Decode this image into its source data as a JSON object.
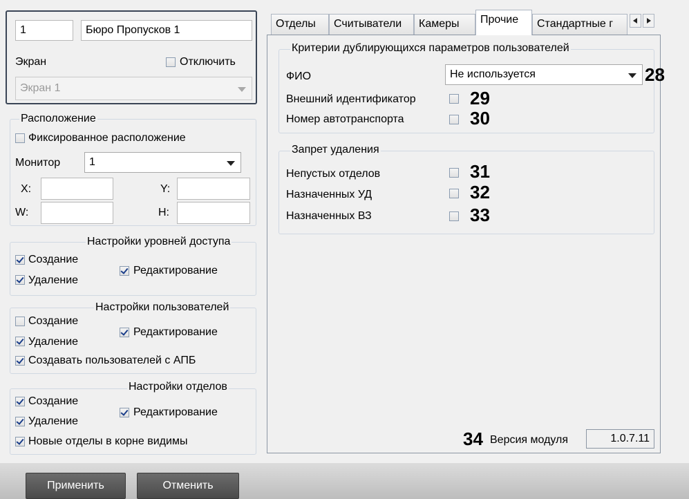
{
  "header": {
    "id_value": "1",
    "name_value": "Бюро Пропусков 1",
    "screen_label": "Экран",
    "disable_label": "Отключить",
    "screen_value": "Экран 1"
  },
  "location": {
    "title": "Расположение",
    "fixed_label": "Фиксированное расположение",
    "monitor_label": "Монитор",
    "monitor_value": "1",
    "x_label": "X:",
    "y_label": "Y:",
    "w_label": "W:",
    "h_label": "H:",
    "x_value": "",
    "y_value": "",
    "w_value": "",
    "h_value": ""
  },
  "access_levels": {
    "title": "Настройки уровней доступа",
    "create": "Создание",
    "delete": "Удаление",
    "edit": "Редактирование"
  },
  "users": {
    "title": "Настройки пользователей",
    "create": "Создание",
    "delete": "Удаление",
    "edit": "Редактирование",
    "apb": "Создавать пользователей с АПБ"
  },
  "departments": {
    "title": "Настройки отделов",
    "create": "Создание",
    "delete": "Удаление",
    "edit": "Редактирование",
    "root": "Новые отделы в корне видимы"
  },
  "tabs": [
    {
      "label": "Отделы"
    },
    {
      "label": "Считыватели"
    },
    {
      "label": "Камеры"
    },
    {
      "label": "Прочие"
    },
    {
      "label": "Стандартные г"
    }
  ],
  "criteria": {
    "title": "Критерии дублирующихся параметров пользователей",
    "fio_label": "ФИО",
    "fio_value": "Не используется",
    "external_id_label": "Внешний идентификатор",
    "vehicle_label": "Номер автотранспорта"
  },
  "deletion": {
    "title": "Запрет удаления",
    "nonempty_label": "Непустых отделов",
    "assigned_ud_label": "Назначенных УД",
    "assigned_vz_label": "Назначенных ВЗ"
  },
  "version": {
    "label": "Версия модуля",
    "value": "1.0.7.11"
  },
  "callouts": {
    "c28": "28",
    "c29": "29",
    "c30": "30",
    "c31": "31",
    "c32": "32",
    "c33": "33",
    "c34": "34"
  },
  "buttons": {
    "apply": "Применить",
    "cancel": "Отменить"
  }
}
